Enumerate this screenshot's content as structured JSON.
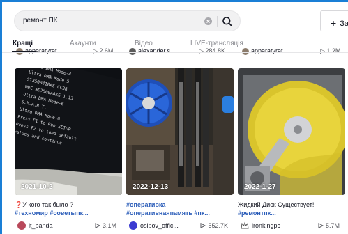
{
  "search": {
    "query": "ремонт ПК"
  },
  "header": {
    "upload_label": "За"
  },
  "tabs": [
    {
      "label": "Кращі",
      "active": true
    },
    {
      "label": "Акаунти",
      "active": false
    },
    {
      "label": "Відео",
      "active": false
    },
    {
      "label": "LIVE-трансляція",
      "active": false
    }
  ],
  "previous_row": [
    {
      "author": "apparatyrat",
      "views": "2.6M"
    },
    {
      "author": "alexander.s...",
      "views": "284.8K"
    },
    {
      "author": "apparatyrat",
      "views": "1.2M"
    }
  ],
  "videos": [
    {
      "date": "2021-10-2",
      "caption": "❓У кого так было ?",
      "tags": "#техномир #советыпк...",
      "author": "it_banda",
      "views": "3.1M",
      "avatar_color": "#b8485a",
      "screen_lines": [
        "Ultra DMA Mode-4",
        "Ultra DMA Mode-5",
        "ST3500418AS CC38",
        "WDC WD7500AAKS 1.13",
        "Ultra DMA Mode-6",
        "S.M.A.R.T.",
        "Ultra DMA Mode-6",
        "Press F1 to Run SETUP",
        "Press F2 to load default",
        "values and continue"
      ]
    },
    {
      "date": "2022-12-13",
      "caption": "#оперативка",
      "tags": "#оперативнаяпамять #пк...",
      "author": "osipov_offic...",
      "views": "552.7K",
      "avatar_color": "#3b3bd1"
    },
    {
      "date": "2022-1-27",
      "caption": "Жидкий Диск Существует!",
      "tags": "#ремонтпк...",
      "author": "ironkingpc",
      "views": "5.7M",
      "avatar_color": "#6a6a6a"
    }
  ],
  "colors": {
    "accent": "#fe2c55",
    "link": "#2b5db9",
    "frame": "#1a7fd6"
  }
}
